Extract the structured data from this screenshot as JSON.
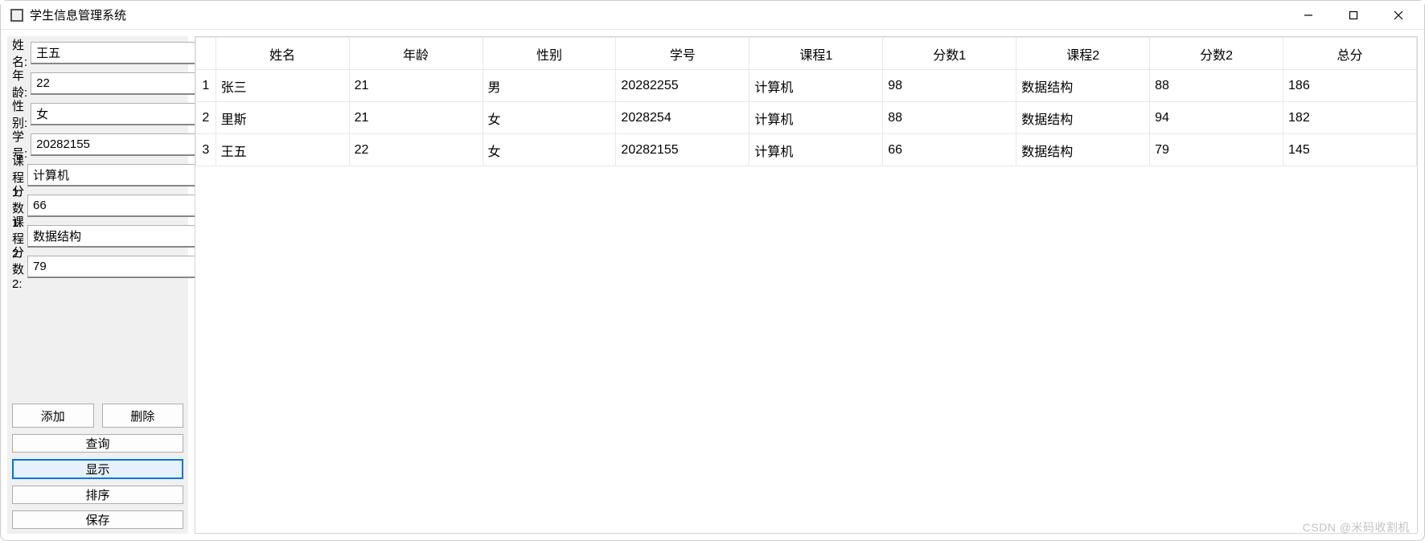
{
  "window": {
    "title": "学生信息管理系统"
  },
  "form": {
    "fields": [
      {
        "label": "姓名:",
        "value": "王五"
      },
      {
        "label": "年龄:",
        "value": "22"
      },
      {
        "label": "性别:",
        "value": "女"
      },
      {
        "label": "学号:",
        "value": "20282155"
      },
      {
        "label": "课程1:",
        "value": "计算机"
      },
      {
        "label": "分数1:",
        "value": "66"
      },
      {
        "label": "课程2:",
        "value": "数据结构"
      },
      {
        "label": "分数2:",
        "value": "79"
      }
    ]
  },
  "buttons": {
    "add": "添加",
    "delete": "删除",
    "query": "查询",
    "display": "显示",
    "sort": "排序",
    "save": "保存"
  },
  "table": {
    "headers": [
      "姓名",
      "年龄",
      "性别",
      "学号",
      "课程1",
      "分数1",
      "课程2",
      "分数2",
      "总分"
    ],
    "rows": [
      {
        "n": "1",
        "cells": [
          "张三",
          "21",
          "男",
          "20282255",
          "计算机",
          "98",
          "数据结构",
          "88",
          "186"
        ]
      },
      {
        "n": "2",
        "cells": [
          "里斯",
          "21",
          "女",
          "2028254",
          "计算机",
          "88",
          "数据结构",
          "94",
          "182"
        ]
      },
      {
        "n": "3",
        "cells": [
          "王五",
          "22",
          "女",
          "20282155",
          "计算机",
          "66",
          "数据结构",
          "79",
          "145"
        ]
      }
    ]
  },
  "watermark": "CSDN @米码收割机"
}
